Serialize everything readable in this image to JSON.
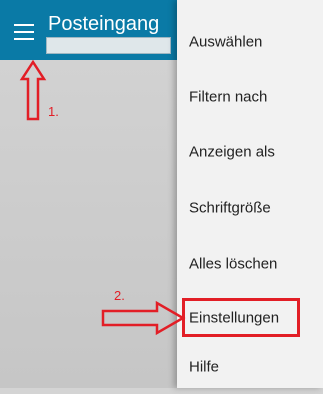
{
  "app_bar": {
    "title": "Posteingang",
    "menu_icon": "hamburger-icon",
    "background": "#0a7aa6"
  },
  "menu": {
    "items": [
      {
        "label": "Auswählen"
      },
      {
        "label": "Filtern nach"
      },
      {
        "label": "Anzeigen als"
      },
      {
        "label": "Schriftgröße"
      },
      {
        "label": "Alles löschen"
      },
      {
        "label": "Einstellungen"
      },
      {
        "label": "Hilfe"
      }
    ]
  },
  "annotations": {
    "step1": "1.",
    "step2": "2.",
    "color": "#e21e26"
  }
}
